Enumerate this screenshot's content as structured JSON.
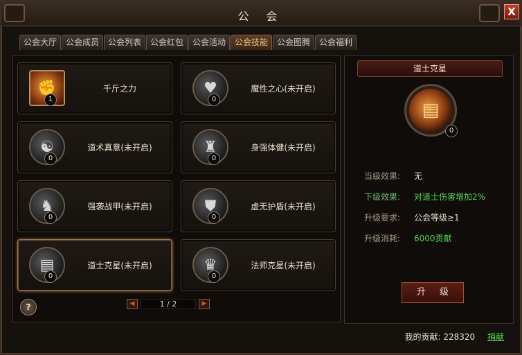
{
  "window": {
    "title": "公 会",
    "close_label": "X"
  },
  "tabs": [
    {
      "label": "公会大厅",
      "active": false
    },
    {
      "label": "公会成员",
      "active": false
    },
    {
      "label": "公会列表",
      "active": false
    },
    {
      "label": "公会红包",
      "active": false
    },
    {
      "label": "公会活动",
      "active": false
    },
    {
      "label": "公会技能",
      "active": true
    },
    {
      "label": "公会图腾",
      "active": false
    },
    {
      "label": "公会福利",
      "active": false
    }
  ],
  "skills": [
    {
      "name": "千斤之力",
      "level": "1",
      "icon": "fist-icon",
      "unlocked": true
    },
    {
      "name": "魔性之心(未开启)",
      "level": "0",
      "icon": "heart-icon",
      "unlocked": false
    },
    {
      "name": "道术真意(未开启)",
      "level": "0",
      "icon": "taoist-figure-icon",
      "unlocked": false
    },
    {
      "name": "身强体健(未开启)",
      "level": "0",
      "icon": "strongman-icon",
      "unlocked": false
    },
    {
      "name": "强袭战甲(未开启)",
      "level": "0",
      "icon": "armor-icon",
      "unlocked": false
    },
    {
      "name": "虚无护盾(未开启)",
      "level": "0",
      "icon": "shield-icon",
      "unlocked": false
    },
    {
      "name": "道士克星(未开启)",
      "level": "0",
      "icon": "scroll-icon",
      "unlocked": false,
      "selected": true
    },
    {
      "name": "法师克星(未开启)",
      "level": "0",
      "icon": "mage-icon",
      "unlocked": false
    }
  ],
  "help_label": "?",
  "pager": {
    "text": "1 / 2",
    "prev_glyph": "◀",
    "next_glyph": "▶"
  },
  "detail": {
    "title": "道士克星",
    "level": "0",
    "icon": "scroll-icon",
    "current_effect_label": "当级效果:",
    "current_effect_value": "无",
    "next_effect_label": "下级效果:",
    "next_effect_value": "对道士伤害增加2%",
    "requirement_label": "升级要求:",
    "requirement_value": "公会等级≥1",
    "cost_label": "升级消耗:",
    "cost_value": "6000贡献",
    "upgrade_label": "升级"
  },
  "footer": {
    "contribution_label": "我的贡献:",
    "contribution_value": "228320",
    "donate_label": "捐献"
  },
  "colors": {
    "accent": "#4fd84a",
    "active_tab": "#f0c080",
    "close": "#c0392b"
  }
}
